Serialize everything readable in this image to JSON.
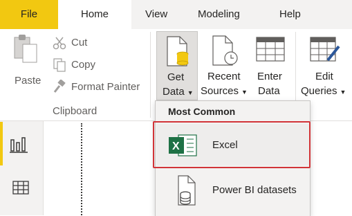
{
  "tabs": {
    "file": "File",
    "home": "Home",
    "view": "View",
    "modeling": "Modeling",
    "help": "Help"
  },
  "clipboard": {
    "paste": "Paste",
    "cut": "Cut",
    "copy": "Copy",
    "format_painter": "Format Painter",
    "group_label": "Clipboard"
  },
  "data_group": {
    "get_data": [
      "Get",
      "Data"
    ],
    "recent_sources": [
      "Recent",
      "Sources"
    ],
    "enter_data": [
      "Enter",
      "Data"
    ],
    "edit_queries": [
      "Edit",
      "Queries"
    ]
  },
  "dropdown": {
    "header": "Most Common",
    "items": [
      {
        "label": "Excel",
        "icon": "excel-icon"
      },
      {
        "label": "Power BI datasets",
        "icon": "dataset-icon"
      }
    ]
  },
  "rail": {
    "items": [
      "report-view-icon",
      "data-view-icon"
    ]
  },
  "colors": {
    "accent": "#f2c811",
    "highlight": "#d13438",
    "excel_green": "#1e7145"
  }
}
